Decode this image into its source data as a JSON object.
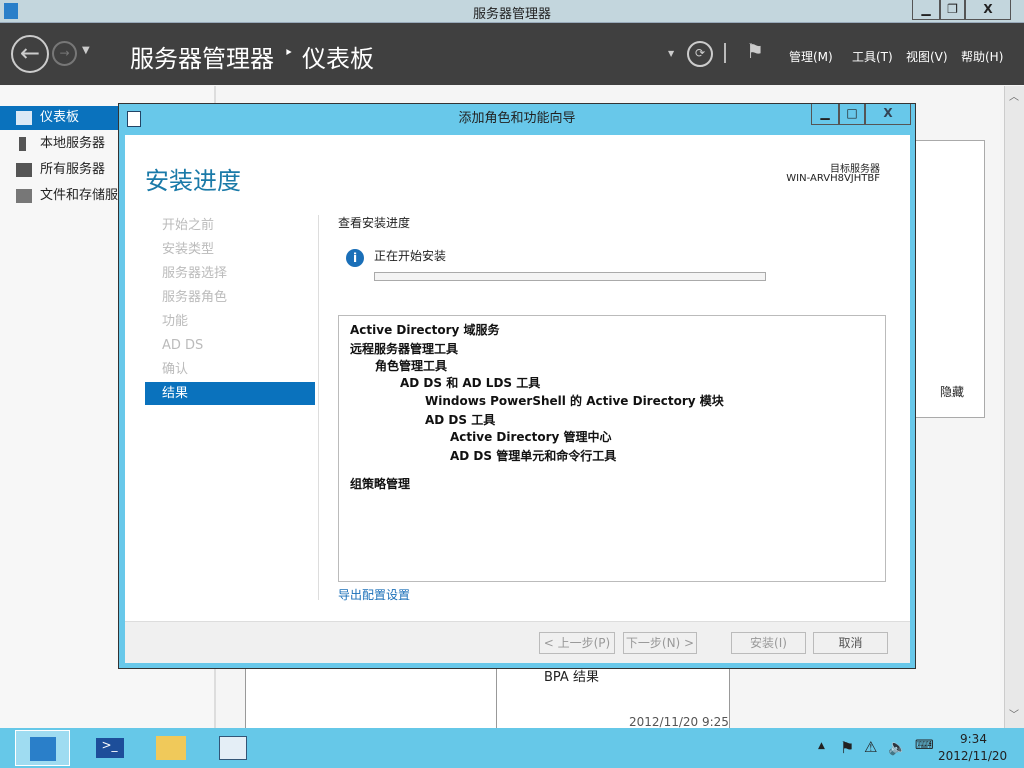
{
  "window": {
    "title": "服务器管理器",
    "min": "▁",
    "restore": "❐",
    "close": "X"
  },
  "header": {
    "breadcrumb_root": "服务器管理器",
    "breadcrumb_sep": "‣",
    "breadcrumb_current": "仪表板",
    "menus": [
      "管理(M)",
      "工具(T)",
      "视图(V)",
      "帮助(H)"
    ]
  },
  "sidebar": {
    "items": [
      {
        "label": "仪表板",
        "icon": "dashboard-icon"
      },
      {
        "label": "本地服务器",
        "icon": "server-icon"
      },
      {
        "label": "所有服务器",
        "icon": "servers-icon"
      },
      {
        "label": "文件和存储服务",
        "icon": "storage-icon"
      }
    ]
  },
  "background": {
    "hide": "隐藏",
    "bpa": "BPA 结果",
    "timestamp": "2012/11/20 9:25"
  },
  "dialog": {
    "title": "添加角色和功能向导",
    "page_title": "安装进度",
    "target_label": "目标服务器",
    "target_name": "WIN-ARVH8VJHTBF",
    "nav": [
      "开始之前",
      "安装类型",
      "服务器选择",
      "服务器角色",
      "功能",
      "AD DS",
      "确认",
      "结果"
    ],
    "section": "查看安装进度",
    "status": "正在开始安装",
    "progress": 0,
    "tree": [
      {
        "t": "Active Directory 域服务",
        "l": 0
      },
      {
        "t": "远程服务器管理工具",
        "l": 0
      },
      {
        "t": "角色管理工具",
        "l": 1
      },
      {
        "t": "AD DS 和 AD LDS 工具",
        "l": 2
      },
      {
        "t": "Windows PowerShell 的 Active Directory 模块",
        "l": 3
      },
      {
        "t": "AD DS 工具",
        "l": 3
      },
      {
        "t": "Active Directory 管理中心",
        "l": 4
      },
      {
        "t": "AD DS 管理单元和命令行工具",
        "l": 4
      },
      {
        "t": "组策略管理",
        "l": 0
      }
    ],
    "export_link": "导出配置设置",
    "buttons": {
      "prev": "< 上一步(P)",
      "next": "下一步(N) >",
      "install": "安装(I)",
      "cancel": "取消"
    }
  },
  "taskbar": {
    "time": "9:34",
    "date": "2012/11/20"
  }
}
